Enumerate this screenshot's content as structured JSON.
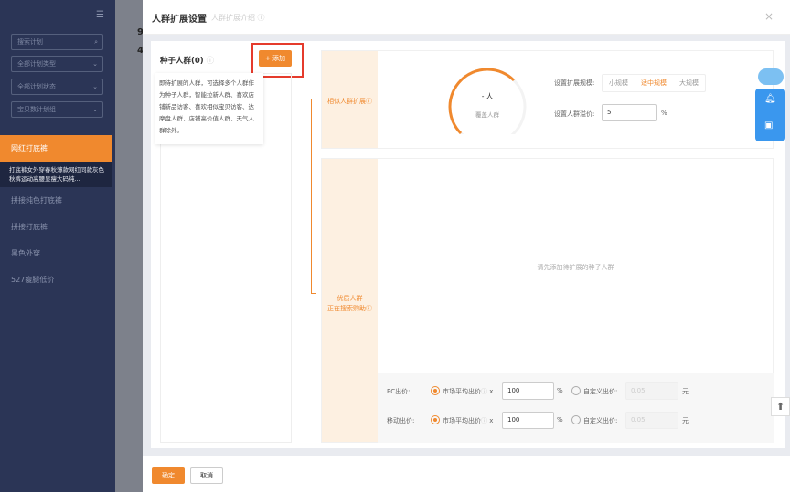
{
  "sidebar": {
    "search_placeholder": "搜索计划",
    "filters": [
      "全部计划类型",
      "全部计划状态",
      "宝贝数计划组"
    ],
    "active_item": "网红打底裤",
    "active_desc": "打底裤女外穿春秋薄款网红同款灰色秋裤运动高腰显瘦大码纯...",
    "items": [
      "拼接纯色打底裤",
      "拼接打底裤",
      "黑色外穿",
      "527瘦腿低价"
    ]
  },
  "background": {
    "digits": [
      "9",
      "4"
    ]
  },
  "modal": {
    "title": "人群扩展设置",
    "subtitle": "人群扩展介绍",
    "seed": {
      "title": "种子人群(0)",
      "add_label": "+ 添加",
      "description": "即待扩展的人群，可选择多个人群作为种子人群，智能拉新人群、喜欢店铺新品访客、喜欢相似宝贝访客、达摩盘人群、店铺高价值人群、天气人群除外。"
    },
    "similar": {
      "label": "相似人群扩展",
      "gauge_value": "- 人",
      "gauge_label": "覆盖人群",
      "scale_label": "设置扩展规模:",
      "scale_options": [
        "小规模",
        "适中规模",
        "大规模"
      ],
      "scale_selected": 1,
      "premium_label": "设置人群溢价:",
      "premium_value": "5",
      "premium_unit": "%"
    },
    "quality": {
      "label_line1": "优质人群",
      "label_line2": "正在搜索购助",
      "empty_text": "请先添加待扩展的种子人群",
      "bids": [
        {
          "label": "PC出价:",
          "market_label": "市场平均出价",
          "times": "x",
          "value": "100",
          "unit": "%",
          "custom_label": "自定义出价:",
          "custom_placeholder": "0.05",
          "currency": "元"
        },
        {
          "label": "移动出价:",
          "market_label": "市场平均出价",
          "times": "x",
          "value": "100",
          "unit": "%",
          "custom_label": "自定义出价:",
          "custom_placeholder": "0.05",
          "currency": "元"
        }
      ]
    },
    "confirm_label": "确定",
    "cancel_label": "取消"
  },
  "colors": {
    "accent": "#f0892e",
    "sidebar": "#2b3556",
    "highlight": "#e53b2c",
    "widget": "#3a97ee"
  }
}
